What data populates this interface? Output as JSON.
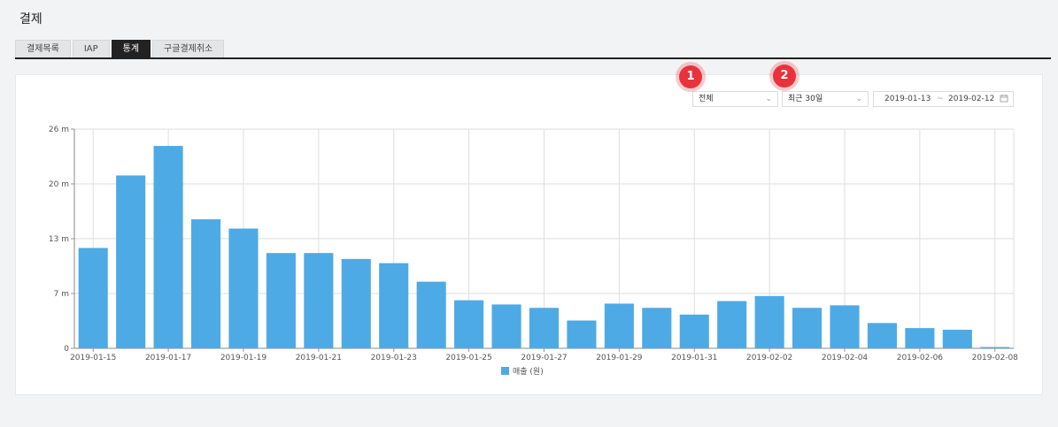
{
  "page": {
    "title": "결제"
  },
  "tabs": [
    {
      "label": "결제목록"
    },
    {
      "label": "IAP"
    },
    {
      "label": "통계"
    },
    {
      "label": "구글결제취소"
    }
  ],
  "filters": {
    "type_select": "전체",
    "period_select": "최근 30일",
    "date_start": "2019-01-13",
    "date_sep": "~",
    "date_end": "2019-02-12"
  },
  "badges": {
    "one": "1",
    "two": "2"
  },
  "colors": {
    "bar": "#4eaae4",
    "active_tab": "#222222",
    "badge": "#e8333c"
  },
  "icons": {
    "chevron": "chevron-down-icon",
    "calendar": "calendar-icon"
  },
  "chart_data": {
    "type": "bar",
    "categories": [
      "2019-01-15",
      "2019-01-16",
      "2019-01-17",
      "2019-01-18",
      "2019-01-19",
      "2019-01-20",
      "2019-01-21",
      "2019-01-22",
      "2019-01-23",
      "2019-01-24",
      "2019-01-25",
      "2019-01-26",
      "2019-01-27",
      "2019-01-28",
      "2019-01-29",
      "2019-01-30",
      "2019-01-31",
      "2019-02-01",
      "2019-02-02",
      "2019-02-03",
      "2019-02-04",
      "2019-02-05",
      "2019-02-06",
      "2019-02-07",
      "2019-02-08"
    ],
    "x_tick_labels": [
      "2019-01-15",
      "2019-01-17",
      "2019-01-19",
      "2019-01-21",
      "2019-01-23",
      "2019-01-25",
      "2019-01-27",
      "2019-01-29",
      "2019-01-31",
      "2019-02-02",
      "2019-02-04",
      "2019-02-06",
      "2019-02-08"
    ],
    "series": [
      {
        "name": "매출 (원)",
        "values": [
          11.9,
          20.5,
          24.0,
          15.3,
          14.2,
          11.3,
          11.3,
          10.6,
          10.1,
          7.9,
          5.7,
          5.2,
          4.8,
          3.3,
          5.3,
          4.8,
          4.0,
          5.6,
          6.2,
          4.8,
          5.1,
          3.0,
          2.4,
          2.2,
          0.15
        ]
      }
    ],
    "y_ticks": [
      "0",
      "7 m",
      "13 m",
      "20 m",
      "26 m"
    ],
    "ylim": [
      0,
      26
    ],
    "grid": true,
    "legend": "bottom"
  }
}
